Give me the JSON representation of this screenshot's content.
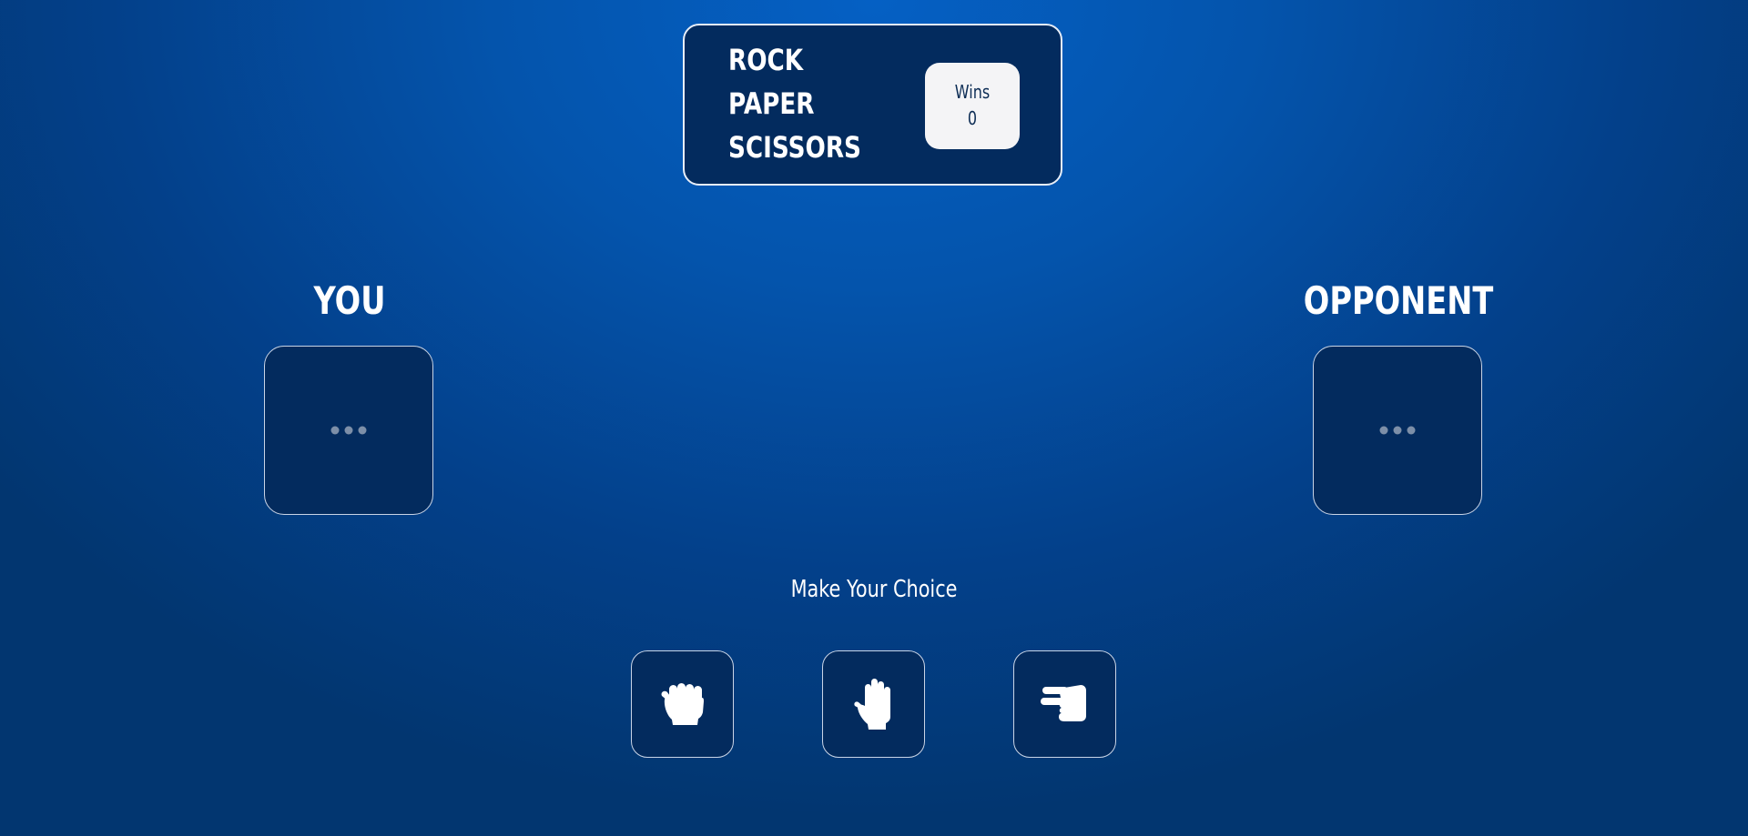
{
  "scoreboard": {
    "title_lines": [
      "ROCK",
      "PAPER",
      "SCISSORS"
    ],
    "wins_label": "Wins",
    "wins_value": "0"
  },
  "players": {
    "you_label": "YOU",
    "opponent_label": "OPPONENT"
  },
  "slots": {
    "you_icon": "ellipsis-icon",
    "opponent_icon": "ellipsis-icon"
  },
  "prompt": "Make Your Choice",
  "choices": [
    {
      "id": "rock",
      "icon": "hand-rock-icon"
    },
    {
      "id": "paper",
      "icon": "hand-paper-icon"
    },
    {
      "id": "scissors",
      "icon": "hand-scissors-icon"
    }
  ],
  "colors": {
    "background": "#0454ac",
    "panel": "#032b5e",
    "border": "#e8eef8",
    "wins_box": "#f4f4f6",
    "wins_text": "#0d2d55",
    "dots": "#7d8fa8"
  }
}
